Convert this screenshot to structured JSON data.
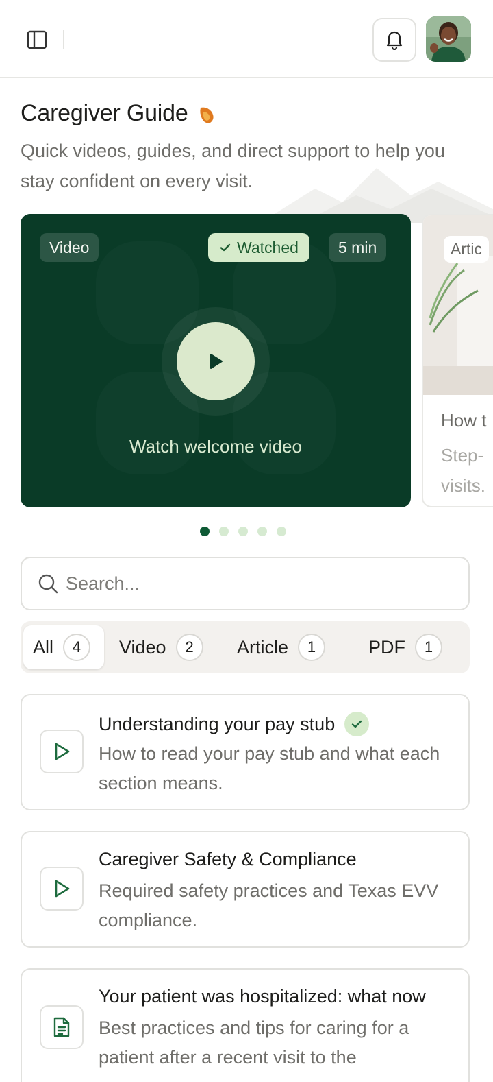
{
  "header": {
    "sidebar_toggle_icon": "sidebar-panel-icon",
    "notification_icon": "bell-icon",
    "avatar_alt": "user avatar"
  },
  "page": {
    "title": "Caregiver Guide",
    "subtitle": "Quick videos, guides, and direct support to help you stay confident on every visit."
  },
  "carousel": {
    "active_index": 0,
    "total": 5,
    "featured": {
      "type_label": "Video",
      "watched_label": "Watched",
      "duration_label": "5 min",
      "caption": "Watch welcome video"
    },
    "next": {
      "type_label": "Artic",
      "title": "How t",
      "desc": "Step-\nvisits."
    }
  },
  "search": {
    "placeholder": "Search..."
  },
  "tabs": [
    {
      "label": "All",
      "count": "4"
    },
    {
      "label": "Video",
      "count": "2"
    },
    {
      "label": "Article",
      "count": "1"
    },
    {
      "label": "PDF",
      "count": "1"
    }
  ],
  "items": [
    {
      "title": "Understanding your pay stub",
      "desc": "How to read your pay stub and what each section means.",
      "icon": "play-icon",
      "watched": true
    },
    {
      "title": "Caregiver Safety & Compliance",
      "desc": "Required safety practices and Texas EVV compliance.",
      "icon": "play-icon",
      "watched": false
    },
    {
      "title": "Your patient was hospitalized: what now",
      "desc": "Best practices and tips for caring for a patient after a recent visit to the",
      "icon": "document-icon",
      "watched": false
    }
  ],
  "colors": {
    "brand_dark_green": "#0a3b27",
    "accent_green": "#0e5a35",
    "light_green": "#d6ebcb"
  }
}
